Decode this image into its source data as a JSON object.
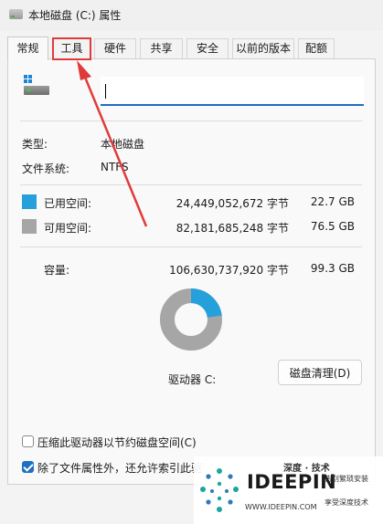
{
  "window": {
    "title": "本地磁盘 (C:) 属性"
  },
  "tabs": [
    "常规",
    "工具",
    "硬件",
    "共享",
    "安全",
    "以前的版本",
    "配额"
  ],
  "active_tab": "常规",
  "general": {
    "name_value": "",
    "type_label": "类型:",
    "type_value": "本地磁盘",
    "fs_label": "文件系统:",
    "fs_value": "NTFS",
    "used": {
      "label": "已用空间:",
      "bytes": "24,449,052,672 字节",
      "size": "22.7 GB",
      "color": "#26a0da"
    },
    "free": {
      "label": "可用空间:",
      "bytes": "82,181,685,248 字节",
      "size": "76.5 GB",
      "color": "#a6a6a6"
    },
    "capacity": {
      "label": "容量:",
      "bytes": "106,630,737,920 字节",
      "size": "99.3 GB"
    },
    "used_fraction": 0.229,
    "drive_label": "驱动器 C:",
    "cleanup_button": "磁盘清理(D)",
    "compress_label": "压缩此驱动器以节约磁盘空间(C)",
    "compress_checked": false,
    "index_label": "除了文件属性外，还允许索引此驱",
    "index_checked": true
  },
  "annotation": {
    "color": "#e03b3b"
  },
  "watermark": {
    "top_text": "深度 · 技术",
    "brand": "IDEEPIN",
    "url": "WWW.IDEEPIN.COM",
    "slogan1": "告别繁琐安装",
    "slogan2": "享受深度技术"
  }
}
